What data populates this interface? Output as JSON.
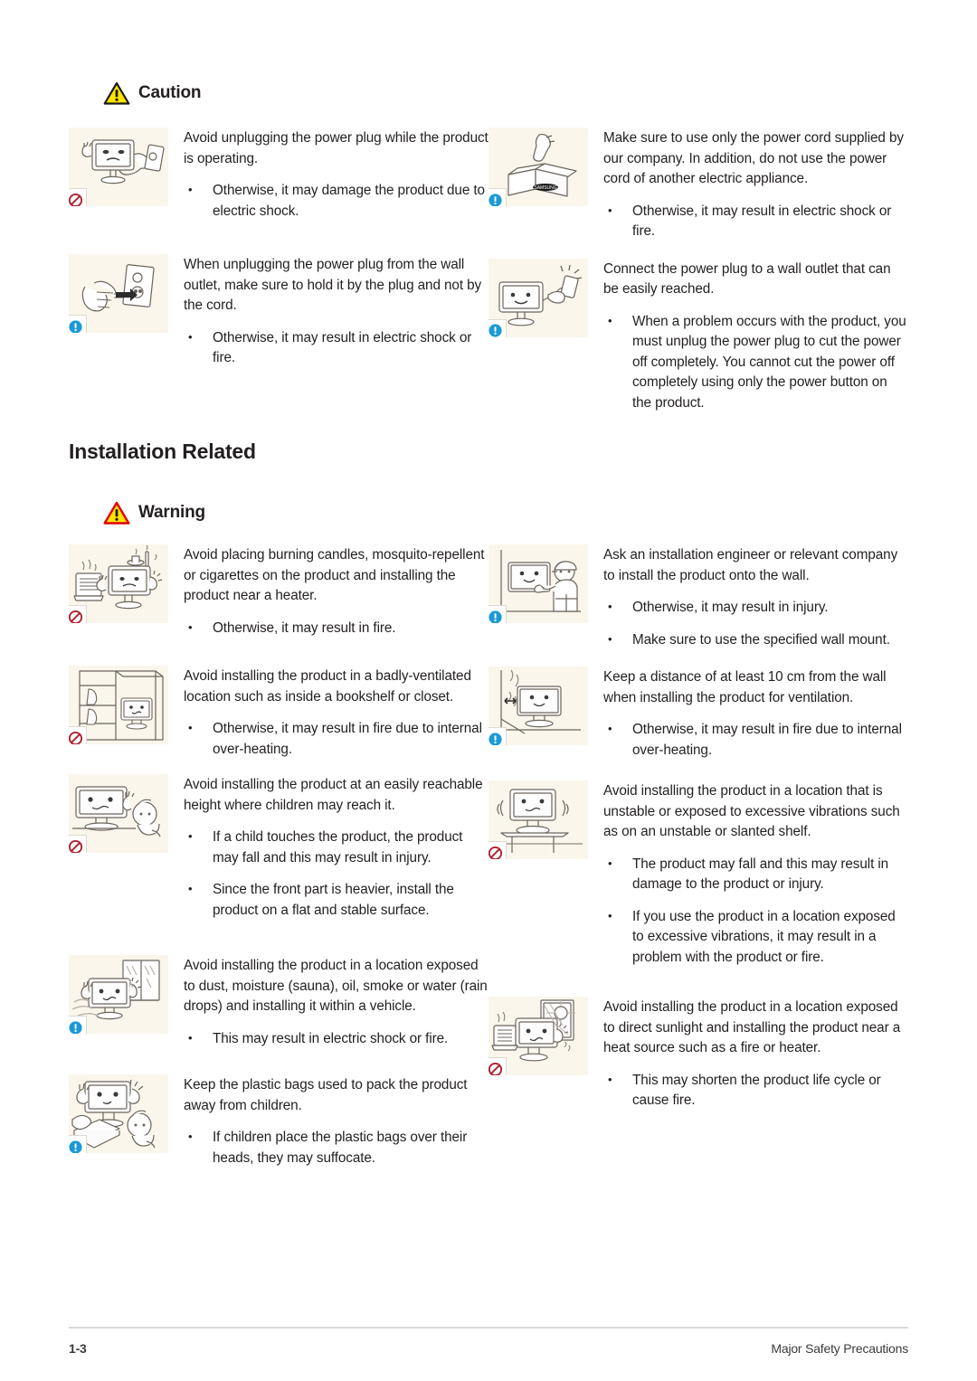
{
  "page": {
    "footer_page_number": "1-3",
    "footer_section": "Major Safety Precautions"
  },
  "colors": {
    "thumb_background": "#faf6ec",
    "caution_triangle_fill": "#ffe400",
    "caution_triangle_stroke": "#1a1a1a",
    "warning_triangle_fill": "#ffe400",
    "warning_triangle_stroke": "#e00000",
    "prohibition_badge": "#b02030",
    "mandatory_badge": "#1b9ad6",
    "text": "#231f20",
    "footer_rule": "#d7d9dd"
  },
  "caution_section": {
    "heading": "Caution",
    "icon": "warning-triangle-icon",
    "left_items": [
      {
        "illustration": "monitor-unplugging-while-operating-illustration",
        "badge": "prohibition-icon",
        "lead": "Avoid unplugging the power plug while the product is operating.",
        "bullets": [
          "Otherwise, it may damage the product due to electric shock."
        ]
      },
      {
        "illustration": "hand-pulling-plug-from-outlet-illustration",
        "badge": "mandatory-icon",
        "lead": "When unplugging the power plug from the wall outlet, make sure to hold it by the plug and not by the cord.",
        "bullets": [
          "Otherwise, it may result in electric shock or fire."
        ]
      }
    ],
    "right_items": [
      {
        "illustration": "power-cord-in-samsung-box-illustration",
        "badge": "mandatory-icon",
        "lead": "Make sure to use only the power cord supplied by our company. In addition, do not use the power cord of another electric appliance.",
        "bullets": [
          "Otherwise, it may result in electric shock or fire."
        ]
      },
      {
        "illustration": "monitor-plug-into-reachable-outlet-illustration",
        "badge": "mandatory-icon",
        "lead": "Connect the power plug to a wall outlet that can be easily reached.",
        "bullets": [
          "When a problem occurs with the product, you must unplug the power plug to cut the power off completely. You cannot cut the power off completely using only the power button on the product."
        ]
      }
    ]
  },
  "installation_section": {
    "title": "Installation Related",
    "warning_heading": "Warning",
    "warning_icon": "warning-triangle-icon",
    "left_items": [
      {
        "illustration": "monitor-near-heater-and-candles-illustration",
        "badge": "prohibition-icon",
        "lead": "Avoid placing burning candles,  mosquito-repellent or cigarettes on the product and installing the product near a heater.",
        "bullets": [
          "Otherwise, it may result in fire."
        ]
      },
      {
        "illustration": "monitor-inside-bookshelf-closet-illustration",
        "badge": "prohibition-icon",
        "lead": "Avoid installing the product in a badly-ventilated location such as inside a bookshelf or closet.",
        "bullets": [
          "Otherwise, it may result in fire due to internal over-heating."
        ]
      },
      {
        "illustration": "child-reaching-monitor-illustration",
        "badge": "prohibition-icon",
        "lead": "Avoid installing the product at an easily reachable height where children may reach it.",
        "bullets": [
          "If a child touches the product, the product may fall and this may result in injury.",
          "Since the front part is heavier, install the product on a flat and stable surface."
        ]
      },
      {
        "illustration": "monitor-exposed-to-dust-moisture-illustration",
        "badge": "mandatory-icon",
        "lead": "Avoid installing the product in a location exposed to dust, moisture (sauna), oil, smoke or water (rain drops) and installing it within a vehicle.",
        "bullets": [
          "This may result in electric shock or fire."
        ]
      },
      {
        "illustration": "child-with-plastic-bags-illustration",
        "badge": "mandatory-icon",
        "lead": "Keep the plastic bags used to pack the product away from children.",
        "bullets": [
          " If children place the plastic bags over their heads, they may suffocate."
        ]
      }
    ],
    "right_items": [
      {
        "illustration": "installer-mounting-monitor-on-wall-illustration",
        "badge": "mandatory-icon",
        "lead": "Ask an installation engineer or relevant company to install the product onto the wall.",
        "bullets": [
          "Otherwise, it may result in injury.",
          "Make sure to use the specified wall mount."
        ]
      },
      {
        "illustration": "monitor-distance-from-wall-illustration",
        "badge": "mandatory-icon",
        "lead": "Keep a distance of at least 10 cm from the wall when installing the product for ventilation.",
        "bullets": [
          "Otherwise, it may result in fire due to internal over-heating."
        ]
      },
      {
        "illustration": "monitor-on-unstable-shelf-illustration",
        "badge": "prohibition-icon",
        "lead": "Avoid installing the product in a location that is unstable or exposed to excessive vibrations such as on an unstable or slanted shelf.",
        "bullets": [
          "The product may fall and this may result in damage to the product or injury.",
          "If you use the product in a location exposed to excessive vibrations, it may result in a problem with the product or fire."
        ]
      },
      {
        "illustration": "monitor-in-direct-sunlight-near-heat-illustration",
        "badge": "prohibition-icon",
        "lead": "Avoid installing the product in a location exposed to direct sunlight and installing the product near a heat source such as a fire or heater.",
        "bullets": [
          "This may shorten the product life cycle or cause fire."
        ]
      }
    ]
  }
}
